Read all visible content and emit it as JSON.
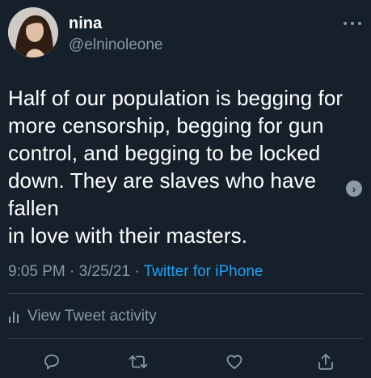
{
  "user": {
    "name": "nina",
    "handle": "@elninoleone"
  },
  "tweet": {
    "text": "Half of our population is begging for\nmore censorship, begging for gun\ncontrol, and begging to be locked\ndown. They are slaves who have fallen\nin love with their masters.",
    "time": "9:05 PM",
    "date": "3/25/21",
    "separator": " · ",
    "source": "Twitter for iPhone"
  },
  "activity": {
    "label": "View Tweet activity"
  },
  "icons": {
    "more": "more-horizontal-icon",
    "activity": "bar-chart-icon",
    "reply": "reply-icon",
    "retweet": "retweet-icon",
    "like": "heart-icon",
    "share": "share-icon"
  },
  "colors": {
    "background": "#15202b",
    "text": "#ffffff",
    "secondary": "#8899a6",
    "link": "#1da1f2",
    "divider": "#38444d"
  }
}
